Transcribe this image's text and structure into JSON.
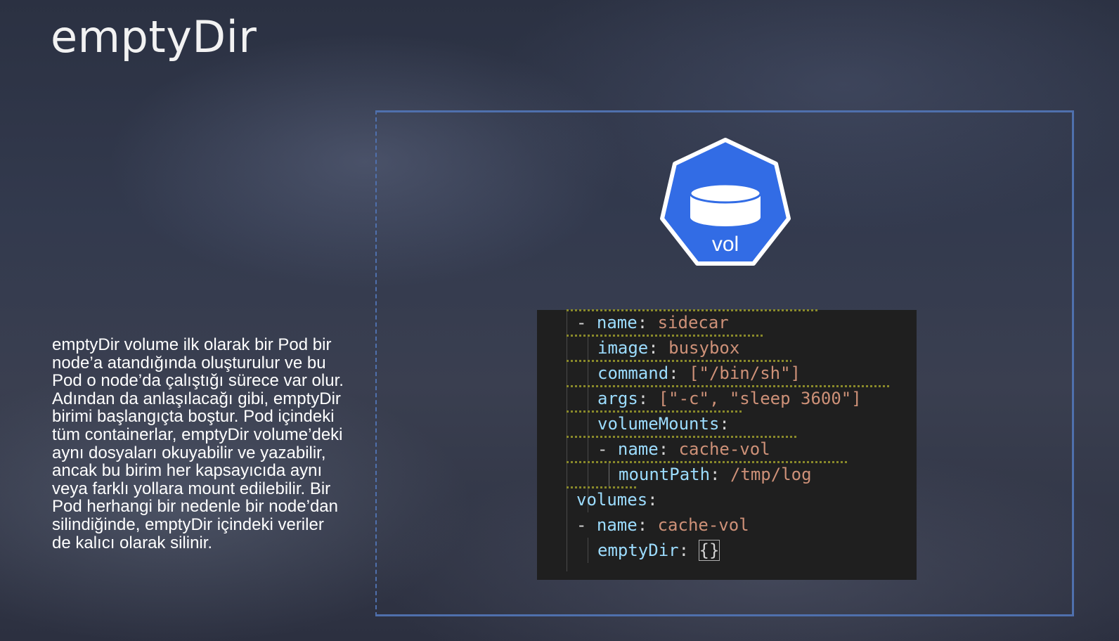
{
  "slide": {
    "title": "emptyDir",
    "description": "emptyDir volume ilk olarak bir Pod bir node’a atandığında oluşturulur ve bu Pod o node’da çalıştığı sürece var olur. Adından da anlaşılacağı gibi, emptyDir birimi başlangıçta boştur. Pod içindeki tüm containerlar, emptyDir volume’deki aynı dosyaları okuyabilir ve yazabilir, ancak bu birim her kapsayıcıda aynı veya farklı yollara mount edilebilir. Bir Pod herhangi bir nedenle bir node’dan silindiğinde, emptyDir içindeki veriler de kalıcı olarak silinir."
  },
  "icon": {
    "label": "vol",
    "name": "volume-icon",
    "fill": "#326ce5"
  },
  "code": {
    "lines": [
      {
        "dash": "- ",
        "key": "name",
        "value": "sidecar"
      },
      {
        "key": "image",
        "value": "busybox"
      },
      {
        "key": "command",
        "value": "[\"/bin/sh\"]"
      },
      {
        "key": "args",
        "value": "[\"-c\", \"sleep 3600\"]"
      },
      {
        "key": "volumeMounts",
        "value": ""
      },
      {
        "dash": "- ",
        "key": "name",
        "value": "cache-vol"
      },
      {
        "key": "mountPath",
        "value": "/tmp/log"
      },
      {
        "key": "volumes",
        "value": ""
      },
      {
        "dash": "- ",
        "key": "name",
        "value": "cache-vol"
      },
      {
        "key": "emptyDir",
        "value": "{}"
      }
    ]
  },
  "colors": {
    "frame": "#4f70ad",
    "code_bg": "#1f1f1f",
    "key": "#9cdcfe",
    "string": "#ce9178"
  }
}
